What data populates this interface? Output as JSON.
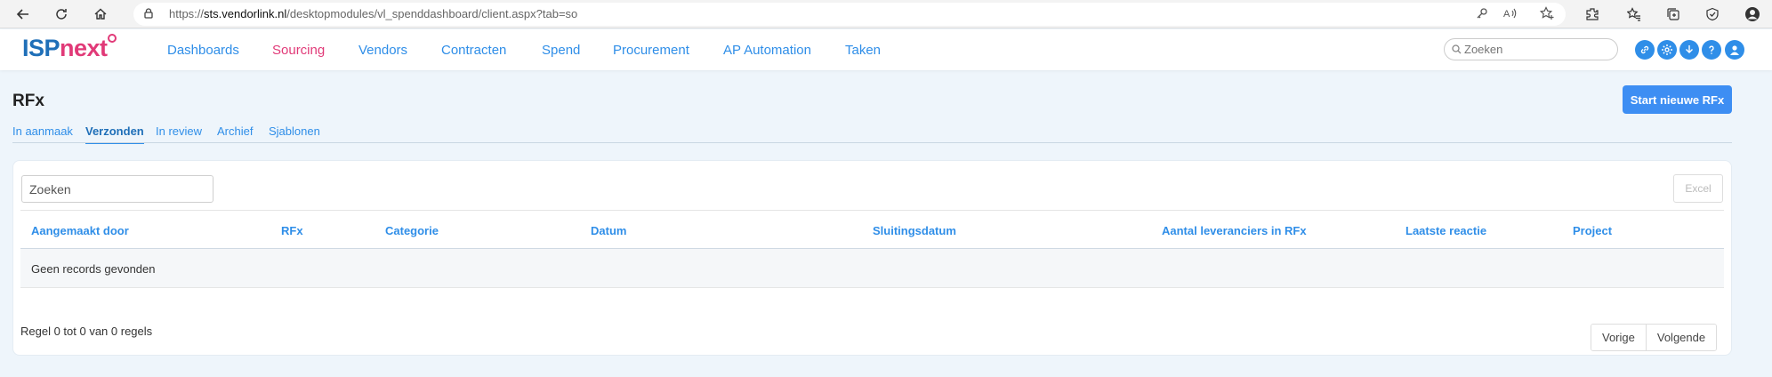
{
  "browser": {
    "url_prefix": "https://",
    "url_host": "sts.vendorlink.nl",
    "url_path": "/desktopmodules/vl_spenddashboard/client.aspx?tab=so"
  },
  "header": {
    "logo_isp": "ISP",
    "logo_next": "next",
    "menu": [
      {
        "label": "Dashboards"
      },
      {
        "label": "Sourcing"
      },
      {
        "label": "Vendors"
      },
      {
        "label": "Contracten"
      },
      {
        "label": "Spend"
      },
      {
        "label": "Procurement"
      },
      {
        "label": "AP Automation"
      },
      {
        "label": "Taken"
      }
    ],
    "active_menu": "Sourcing",
    "search_placeholder": "Zoeken"
  },
  "page": {
    "title": "RFx",
    "primary_button": "Start nieuwe RFx",
    "tabs": [
      {
        "label": "In aanmaak"
      },
      {
        "label": "Verzonden"
      },
      {
        "label": "In review"
      },
      {
        "label": "Archief"
      },
      {
        "label": "Sjablonen"
      }
    ],
    "active_tab": "Verzonden"
  },
  "table": {
    "search_placeholder": "Zoeken",
    "excel_label": "Excel",
    "columns": [
      {
        "label": "Aangemaakt door"
      },
      {
        "label": "RFx"
      },
      {
        "label": "Categorie"
      },
      {
        "label": "Datum"
      },
      {
        "label": "Sluitingsdatum"
      },
      {
        "label": "Aantal leveranciers in RFx"
      },
      {
        "label": "Laatste reactie"
      },
      {
        "label": "Project"
      }
    ],
    "empty_message": "Geen records gevonden",
    "info": "Regel 0 tot 0 van 0 regels",
    "prev_label": "Vorige",
    "next_label": "Volgende"
  },
  "colors": {
    "brand_blue": "#2f8ee8",
    "brand_pink": "#e13a78",
    "primary_button": "#3d8ef3"
  }
}
